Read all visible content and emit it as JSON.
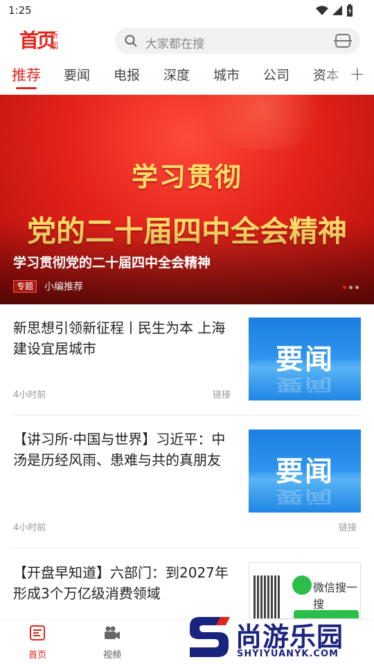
{
  "status_bar": {
    "time": "1:25"
  },
  "header": {
    "logo_main": "首页",
    "logo_side": "新闻",
    "search_placeholder": "大家都在搜"
  },
  "tabs": [
    {
      "label": "推荐",
      "active": true
    },
    {
      "label": "要闻"
    },
    {
      "label": "电报"
    },
    {
      "label": "深度"
    },
    {
      "label": "城市"
    },
    {
      "label": "公司"
    },
    {
      "label": "资本"
    }
  ],
  "banner": {
    "image_line1": "学习贯彻",
    "image_line2": "党的二十届四中全会精神",
    "title": "学习贯彻党的二十届四中全会精神",
    "tag": "专题",
    "source": "小编推荐",
    "slide_count": 3,
    "active_slide": 1
  },
  "articles": [
    {
      "title": "新思想引领新征程丨民生为本 上海建设宜居城市",
      "time": "4小时前",
      "link": "链接",
      "thumb_text": "要闻"
    },
    {
      "title": "【讲习所·中国与世界】习近平：中汤是历经风雨、患难与共的真朋友",
      "time": "4小时前",
      "link": "链接",
      "thumb_text": "要闻"
    },
    {
      "title": "【开盘早知道】六部门：到2027年形成3个万亿级消费领域",
      "thumb_text": "微信搜一搜"
    }
  ],
  "bottom_nav": [
    {
      "label": "首页",
      "icon": "home-news-icon",
      "active": true
    },
    {
      "label": "视频",
      "icon": "video-camera-icon"
    }
  ],
  "watermark": {
    "text": "尚游乐园",
    "url": "SHYIYUANYK.COM"
  },
  "colors": {
    "accent": "#e1251b",
    "thumb_blue": "#1c7fe0",
    "watermark": "#1a237e"
  }
}
